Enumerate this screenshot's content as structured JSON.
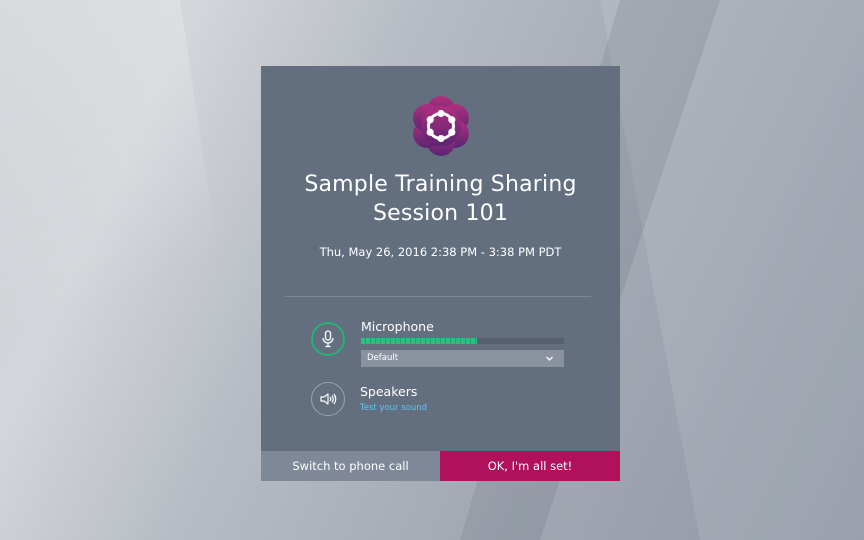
{
  "session": {
    "title_line1": "Sample Training Sharing",
    "title_line2": "Session 101",
    "datetime": "Thu, May 26, 2016 2:38 PM - 3:38 PM PDT"
  },
  "audio": {
    "microphone": {
      "label": "Microphone",
      "level_fraction": 0.57,
      "selected_device": "Default",
      "icon": "microphone-icon"
    },
    "speakers": {
      "label": "Speakers",
      "test_link": "Test your sound",
      "icon": "speaker-icon"
    }
  },
  "buttons": {
    "phone": "Switch to phone call",
    "ok": "OK, I'm all set!"
  },
  "colors": {
    "dialog_bg": "#636e7f",
    "accent": "#b0105c",
    "mic_green": "#22b573",
    "link": "#5fc6f5",
    "logo_purple": "#7a2a7d"
  }
}
